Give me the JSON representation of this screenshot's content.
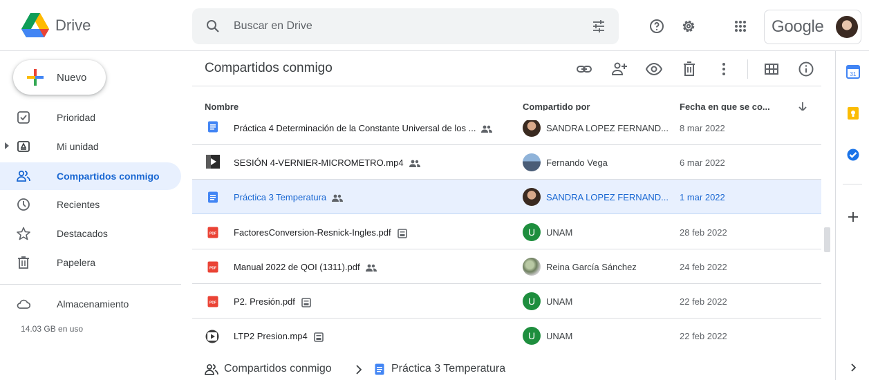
{
  "header": {
    "app_name": "Drive",
    "search_placeholder": "Buscar en Drive",
    "google_label": "Google",
    "icons": [
      "help-icon",
      "settings-icon",
      "apps-icon",
      "search-icon",
      "tune-icon"
    ]
  },
  "sidebar": {
    "new_label": "Nuevo",
    "items": [
      {
        "label": "Prioridad",
        "icon": "priority-icon"
      },
      {
        "label": "Mi unidad",
        "icon": "my-drive-icon"
      },
      {
        "label": "Compartidos conmigo",
        "icon": "shared-icon",
        "active": true
      },
      {
        "label": "Recientes",
        "icon": "clock-icon"
      },
      {
        "label": "Destacados",
        "icon": "star-icon"
      },
      {
        "label": "Papelera",
        "icon": "trash-icon"
      },
      {
        "label": "Almacenamiento",
        "icon": "cloud-icon"
      }
    ],
    "storage_used": "14.03 GB en uso"
  },
  "main": {
    "title": "Compartidos conmigo",
    "toolbar_icons": [
      "link-icon",
      "add-person-icon",
      "preview-icon",
      "delete-icon",
      "more-icon",
      "grid-view-icon",
      "info-icon"
    ],
    "columns": {
      "name": "Nombre",
      "shared_by": "Compartido por",
      "date": "Fecha en que se co..."
    },
    "rows": [
      {
        "name": "Práctica 4 Determinación de la Constante Universal de los ...",
        "type": "doc",
        "badge": "shared",
        "owner": "SANDRA LOPEZ FERNAND...",
        "date": "8 mar 2022"
      },
      {
        "name": "SESIÓN 4-VERNIER-MICROMETRO.mp4",
        "type": "video",
        "badge": "shared",
        "owner": "Fernando Vega",
        "date": "6 mar 2022"
      },
      {
        "name": "Práctica 3 Temperatura",
        "type": "doc",
        "badge": "shared",
        "owner": "SANDRA LOPEZ FERNAND...",
        "date": "1 mar 2022",
        "selected": true
      },
      {
        "name": "FactoresConversion-Resnick-Ingles.pdf",
        "type": "pdf",
        "badge": "shared-drive",
        "owner": "UNAM",
        "date": "28 feb 2022"
      },
      {
        "name": "Manual 2022 de QOI (1311).pdf",
        "type": "pdf",
        "badge": "shared",
        "owner": "Reina García Sánchez",
        "date": "24 feb 2022"
      },
      {
        "name": "P2. Presión.pdf",
        "type": "pdf",
        "badge": "shared-drive",
        "owner": "UNAM",
        "date": "22 feb 2022"
      },
      {
        "name": "LTP2 Presion.mp4",
        "type": "video-play",
        "badge": "shared-drive",
        "owner": "UNAM",
        "date": "22 feb 2022"
      }
    ],
    "owner_avatar_letter": "U",
    "pdf_label": "PDF"
  },
  "breadcrumb": {
    "parent": "Compartidos conmigo",
    "current": "Práctica 3 Temperatura"
  },
  "right_panel": {
    "icons": [
      "calendar-icon",
      "keep-icon",
      "tasks-icon",
      "add-icon",
      "expand-icon"
    ],
    "calendar_day": "31"
  },
  "colors": {
    "accent": "#1967d2",
    "selected_bg": "#e8f0fe",
    "doc_blue": "#4285f4",
    "pdf_red": "#ea4335",
    "unam_green": "#1e8e3e"
  }
}
